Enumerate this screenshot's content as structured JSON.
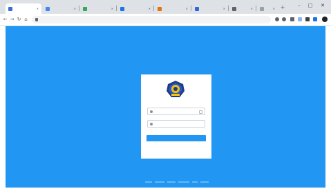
{
  "browser": {
    "tabs": [
      {
        "title": "",
        "favicon_color": "#3b6dd8",
        "active": true
      },
      {
        "title": "",
        "favicon_color": "#4285f4",
        "active": false
      },
      {
        "title": "",
        "favicon_color": "#34a853",
        "active": false
      },
      {
        "title": "",
        "favicon_color": "#1a73e8",
        "active": false
      },
      {
        "title": "",
        "favicon_color": "#e8710a",
        "active": false
      },
      {
        "title": "",
        "favicon_color": "#3367d6",
        "active": false
      },
      {
        "title": "",
        "favicon_color": "#5f6368",
        "active": false
      },
      {
        "title": "",
        "favicon_color": "#9aa0a6",
        "active": false
      }
    ],
    "new_tab_glyph": "+",
    "window_controls": {
      "minimize": "–",
      "maximize": "□",
      "close": "✕"
    },
    "nav": {
      "back": "←",
      "forward": "→",
      "reload": "↻",
      "home": "⌂"
    },
    "omnibox_url": ""
  },
  "page": {
    "background_color": "#2196f3",
    "login": {
      "app_title": "",
      "username_placeholder": "",
      "password_placeholder": "",
      "submit_label": ""
    }
  }
}
